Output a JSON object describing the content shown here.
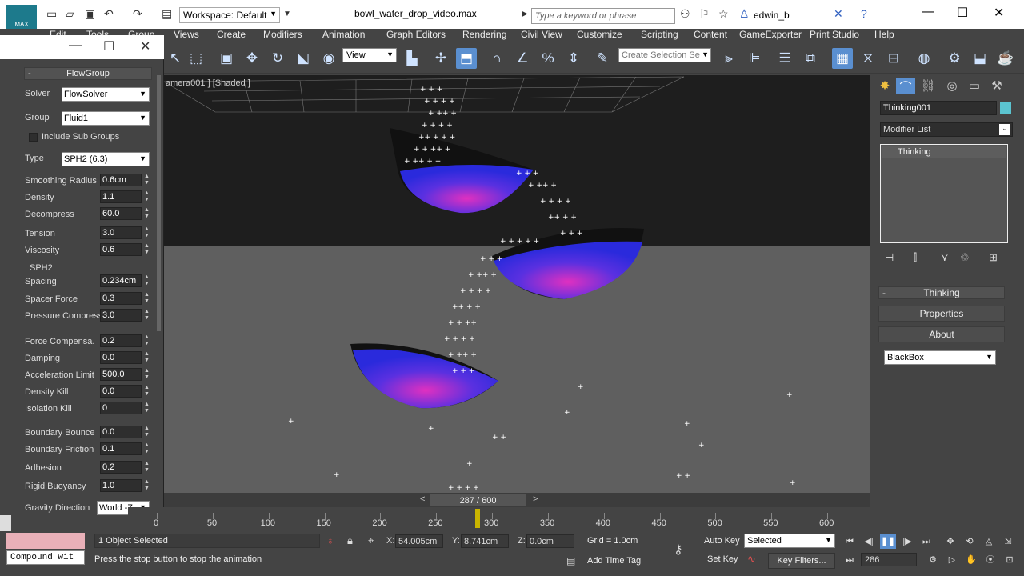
{
  "titlebar": {
    "workspace": "Workspace: Default",
    "document": "bowl_water_drop_video.max",
    "search_placeholder": "Type a keyword or phrase",
    "user": "edwin_b"
  },
  "menubar": [
    "Edit",
    "Tools",
    "Group",
    "Views",
    "Create",
    "Modifiers",
    "Animation",
    "Graph Editors",
    "Rendering",
    "Civil View",
    "Customize",
    "Scripting",
    "Content",
    "GameExporter",
    "Print Studio",
    "Help"
  ],
  "toolbar": {
    "view_dropdown": "View",
    "selection_set_placeholder": "Create Selection Se"
  },
  "flowgroup": {
    "title": "FlowGroup",
    "solver_label": "Solver",
    "solver_value": "FlowSolver",
    "group_label": "Group",
    "group_value": "Fluid1",
    "include_sub_groups": "Include Sub Groups",
    "type_label": "Type",
    "type_value": "SPH2 (6.3)",
    "sph2_section": "SPH2",
    "params": [
      {
        "label": "Smoothing  Radius",
        "value": "0.6cm"
      },
      {
        "label": "Density",
        "value": "1.1"
      },
      {
        "label": "Decompress",
        "value": "60.0"
      },
      {
        "label": "Tension",
        "value": "3.0"
      },
      {
        "label": "Viscosity",
        "value": "0.6"
      },
      {
        "label": "Spacing",
        "value": "0.234cm"
      },
      {
        "label": "Spacer Force",
        "value": "0.3"
      },
      {
        "label": "Pressure Compress",
        "value": "3.0"
      },
      {
        "label": "Force Compensa.",
        "value": "0.2"
      },
      {
        "label": "Damping",
        "value": "0.0"
      },
      {
        "label": "Acceleration Limit",
        "value": "500.0"
      },
      {
        "label": "Density Kill",
        "value": "0.0"
      },
      {
        "label": "Isolation Kill",
        "value": "0"
      },
      {
        "label": "Boundary Bounce",
        "value": "0.0"
      },
      {
        "label": "Boundary Friction",
        "value": "0.1"
      },
      {
        "label": "Adhesion",
        "value": "0.2"
      },
      {
        "label": "Rigid Buoyancy",
        "value": "1.0"
      }
    ],
    "gravity_label": "Gravity Direction",
    "gravity_value": "World -Z"
  },
  "viewport": {
    "label": "amera001 ] [Shaded ]"
  },
  "command_panel": {
    "object_name": "Thinking001",
    "object_color": "#5bc4d0",
    "modifier_list": "Modifier List",
    "stack_item": "Thinking",
    "rollout_title": "Thinking",
    "properties_button": "Properties",
    "about_button": "About",
    "blackbox_dropdown": "BlackBox"
  },
  "timeline": {
    "frame_display": "287 / 600",
    "ticks": [
      "0",
      "50",
      "100",
      "150",
      "200",
      "250",
      "300",
      "350",
      "400",
      "450",
      "500",
      "550",
      "600"
    ],
    "current_frame": 287,
    "total_frames": 600
  },
  "status": {
    "compound_text": "Compound wit",
    "selection_info": "1 Object Selected",
    "prompt": "Press the stop button to stop the animation",
    "x_label": "X:",
    "x_value": "54.005cm",
    "y_label": "Y:",
    "y_value": "8.741cm",
    "z_label": "Z:",
    "z_value": "0.0cm",
    "grid": "Grid = 1.0cm",
    "add_time_tag": "Add Time Tag",
    "auto_key": "Auto Key",
    "set_key": "Set Key",
    "selected_dropdown": "Selected",
    "key_filters": "Key Filters...",
    "frame_field": "286"
  }
}
